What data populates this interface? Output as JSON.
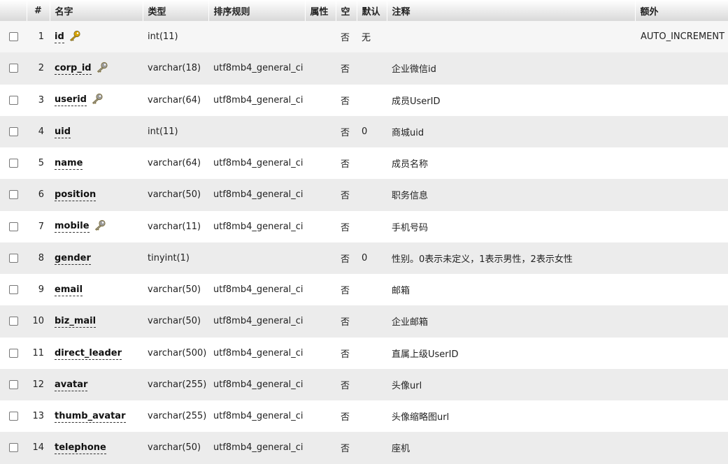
{
  "headers": {
    "num": "#",
    "name": "名字",
    "type": "类型",
    "collation": "排序规则",
    "attributes": "属性",
    "null": "空",
    "default": "默认",
    "comment": "注释",
    "extra": "额外"
  },
  "rows": [
    {
      "num": "1",
      "name": "id",
      "key": "primary",
      "type": "int(11)",
      "collation": "",
      "null": "否",
      "default": "无",
      "comment": "",
      "extra": "AUTO_INCREMENT"
    },
    {
      "num": "2",
      "name": "corp_id",
      "key": "index",
      "type": "varchar(18)",
      "collation": "utf8mb4_general_ci",
      "null": "否",
      "default": "",
      "comment": "企业微信id",
      "extra": ""
    },
    {
      "num": "3",
      "name": "userid",
      "key": "index",
      "type": "varchar(64)",
      "collation": "utf8mb4_general_ci",
      "null": "否",
      "default": "",
      "comment": "成员UserID",
      "extra": ""
    },
    {
      "num": "4",
      "name": "uid",
      "key": "",
      "type": "int(11)",
      "collation": "",
      "null": "否",
      "default": "0",
      "comment": "商城uid",
      "extra": ""
    },
    {
      "num": "5",
      "name": "name",
      "key": "",
      "type": "varchar(64)",
      "collation": "utf8mb4_general_ci",
      "null": "否",
      "default": "",
      "comment": "成员名称",
      "extra": ""
    },
    {
      "num": "6",
      "name": "position",
      "key": "",
      "type": "varchar(50)",
      "collation": "utf8mb4_general_ci",
      "null": "否",
      "default": "",
      "comment": "职务信息",
      "extra": ""
    },
    {
      "num": "7",
      "name": "mobile",
      "key": "index",
      "type": "varchar(11)",
      "collation": "utf8mb4_general_ci",
      "null": "否",
      "default": "",
      "comment": "手机号码",
      "extra": ""
    },
    {
      "num": "8",
      "name": "gender",
      "key": "",
      "type": "tinyint(1)",
      "collation": "",
      "null": "否",
      "default": "0",
      "comment": "性别。0表示未定义，1表示男性，2表示女性",
      "extra": ""
    },
    {
      "num": "9",
      "name": "email",
      "key": "",
      "type": "varchar(50)",
      "collation": "utf8mb4_general_ci",
      "null": "否",
      "default": "",
      "comment": "邮箱",
      "extra": ""
    },
    {
      "num": "10",
      "name": "biz_mail",
      "key": "",
      "type": "varchar(50)",
      "collation": "utf8mb4_general_ci",
      "null": "否",
      "default": "",
      "comment": "企业邮箱",
      "extra": ""
    },
    {
      "num": "11",
      "name": "direct_leader",
      "key": "",
      "type": "varchar(500)",
      "collation": "utf8mb4_general_ci",
      "null": "否",
      "default": "",
      "comment": "直属上级UserID",
      "extra": ""
    },
    {
      "num": "12",
      "name": "avatar",
      "key": "",
      "type": "varchar(255)",
      "collation": "utf8mb4_general_ci",
      "null": "否",
      "default": "",
      "comment": "头像url",
      "extra": ""
    },
    {
      "num": "13",
      "name": "thumb_avatar",
      "key": "",
      "type": "varchar(255)",
      "collation": "utf8mb4_general_ci",
      "null": "否",
      "default": "",
      "comment": "头像缩略图url",
      "extra": ""
    },
    {
      "num": "14",
      "name": "telephone",
      "key": "",
      "type": "varchar(50)",
      "collation": "utf8mb4_general_ci",
      "null": "否",
      "default": "",
      "comment": "座机",
      "extra": ""
    }
  ],
  "colors": {
    "primary_key": "#d9a400",
    "index_key": "#9a9a9a",
    "row_alt": "#ececec"
  }
}
